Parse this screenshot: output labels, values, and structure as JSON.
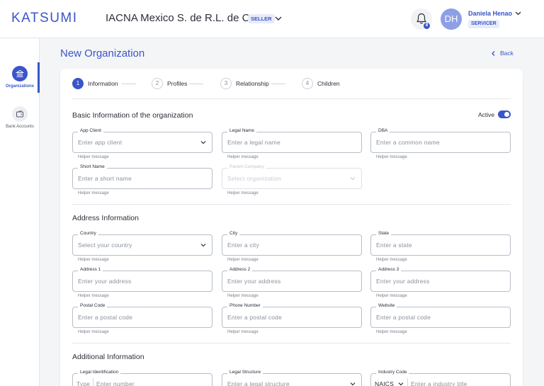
{
  "header": {
    "logo": "KATSUMI",
    "company": "IACNA Mexico S. de R.L. de C.V.",
    "company_badge": "SELLER",
    "notifications_count": "8",
    "avatar_initials": "DH",
    "user_name": "Daniela Henao",
    "user_role": "SERVICER",
    "accent_color": "#3a55c9"
  },
  "sidebar": {
    "items": [
      {
        "label": "Organizations",
        "icon": "bank-icon",
        "active": true
      },
      {
        "label": "Bank Accounts",
        "icon": "wallet-icon",
        "active": false
      }
    ]
  },
  "page": {
    "title": "New Organization",
    "back_label": "Back"
  },
  "steps": [
    {
      "num": "1",
      "label": "Information",
      "active": true
    },
    {
      "num": "2",
      "label": "Profiles",
      "active": false
    },
    {
      "num": "3",
      "label": "Relationship",
      "active": false
    },
    {
      "num": "4",
      "label": "Children",
      "active": false
    }
  ],
  "basic": {
    "title": "Basic Information of the organization",
    "active_label": "Active",
    "active_on": true,
    "app_client": {
      "label": "App Client",
      "placeholder": "Enter app client",
      "helper": "Helper message"
    },
    "legal_name": {
      "label": "Legal Name",
      "placeholder": "Enter a legal name",
      "helper": "Helper message"
    },
    "dba": {
      "label": "DBA",
      "placeholder": "Enter a common name",
      "helper": "Helper message"
    },
    "short_name": {
      "label": "Short Name",
      "placeholder": "Enter a short name",
      "helper": "Helper message"
    },
    "parent_company": {
      "label": "Parent Company",
      "placeholder": "Select organization",
      "helper": "Helper message"
    }
  },
  "address": {
    "title": "Address Information",
    "country": {
      "label": "Country",
      "placeholder": "Select your country",
      "helper": "Helper message"
    },
    "city": {
      "label": "City",
      "placeholder": "Enter a city",
      "helper": "Helper message"
    },
    "state": {
      "label": "State",
      "placeholder": "Enter a state",
      "helper": "Helper message"
    },
    "address1": {
      "label": "Address 1",
      "placeholder": "Enter your address",
      "helper": "Helper message"
    },
    "address2": {
      "label": "Address 2",
      "placeholder": "Enter your address",
      "helper": "Helper message"
    },
    "address3": {
      "label": "Address 3",
      "placeholder": "Enter your address",
      "helper": "Helper message"
    },
    "postal_code": {
      "label": "Postal Code",
      "placeholder": "Enter a postal code",
      "helper": "Helper message"
    },
    "phone": {
      "label": "Phone Number",
      "placeholder": "Enter a postal code",
      "helper": "Helper message"
    },
    "website": {
      "label": "Website",
      "placeholder": "Enter a postal code",
      "helper": "Helper message"
    }
  },
  "additional": {
    "title": "Additional Information",
    "legal_id": {
      "label": "Legal Identification",
      "type_placeholder": "Type",
      "placeholder": "Enter number"
    },
    "legal_structure": {
      "label": "Legal Structure",
      "placeholder": "Enter a legal structure"
    },
    "industry_code": {
      "label": "Industry Code",
      "type_value": "NAICS",
      "placeholder": "Enter a industry title"
    }
  }
}
